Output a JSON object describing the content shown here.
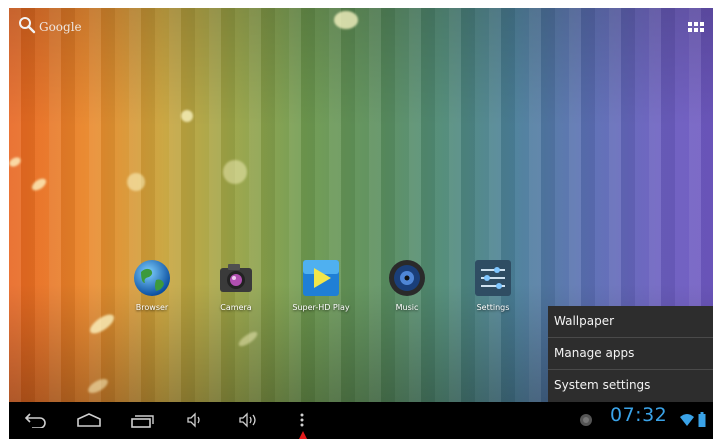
{
  "search": {
    "label": "Google",
    "icon": "search-icon"
  },
  "apps_button_icon": "apps-grid-icon",
  "apps": [
    {
      "label": "Browser",
      "icon": "globe-icon"
    },
    {
      "label": "Camera",
      "icon": "camera-icon"
    },
    {
      "label": "Super-HD Play",
      "icon": "play-icon"
    },
    {
      "label": "Music",
      "icon": "speaker-icon"
    },
    {
      "label": "Settings",
      "icon": "sliders-icon"
    }
  ],
  "menu": {
    "items": [
      "Wallpaper",
      "Manage apps",
      "System settings"
    ]
  },
  "navbar": {
    "buttons": [
      "back-icon",
      "home-icon",
      "recent-apps-icon",
      "volume-down-icon",
      "volume-up-icon",
      "menu-dots-icon"
    ]
  },
  "status": {
    "time": "07:32",
    "accent_color": "#3aa3e8"
  }
}
